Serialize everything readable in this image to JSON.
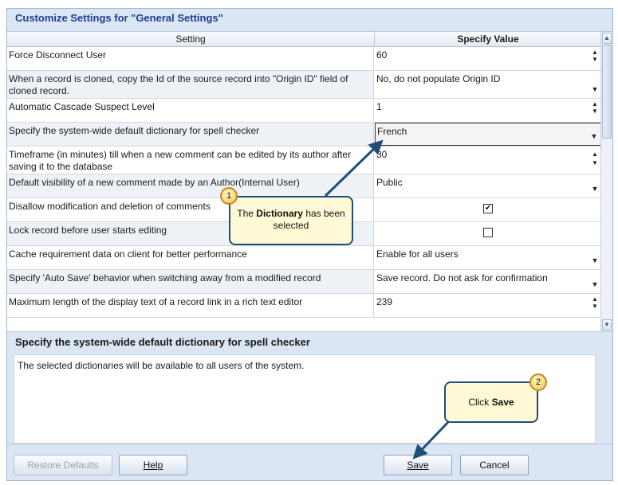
{
  "dialog": {
    "title": "Customize Settings for \"General Settings\""
  },
  "grid": {
    "header_setting": "Setting",
    "header_value": "Specify Value",
    "rows": [
      {
        "setting": "Force Disconnect User",
        "value": "60",
        "control": "spin"
      },
      {
        "setting": "When a record is cloned, copy the Id of the source record into \"Origin ID\" field of cloned record.",
        "value": "No, do not populate Origin ID",
        "control": "dropdown"
      },
      {
        "setting": "Automatic Cascade Suspect Level",
        "value": "1",
        "control": "spin"
      },
      {
        "setting": "Specify the system-wide default dictionary for spell checker",
        "value": "French",
        "control": "dropdown"
      },
      {
        "setting": "Timeframe (in minutes) till when a new comment can be edited by its author after saving it to the database",
        "value": "30",
        "control": "spin"
      },
      {
        "setting": "Default visibility of a new comment made by an Author(Internal User)",
        "value": "Public",
        "control": "dropdown"
      },
      {
        "setting": "Disallow modification and deletion of comments",
        "value": "✔",
        "control": "checkbox"
      },
      {
        "setting": "Lock record before user starts editing",
        "value": "",
        "control": "checkbox"
      },
      {
        "setting": "Cache requirement data on client for better performance",
        "value": "Enable for all users",
        "control": "dropdown"
      },
      {
        "setting": "Specify 'Auto Save' behavior when switching away from a modified record",
        "value": "Save record. Do not ask for confirmation",
        "control": "dropdown"
      },
      {
        "setting": "Maximum length of the display text of a record link in a rich text editor",
        "value": "239",
        "control": "spin"
      }
    ]
  },
  "description": {
    "title": "Specify the system-wide default dictionary for spell checker",
    "body": "The selected dictionaries will be available to all users of the system."
  },
  "buttons": {
    "restore_defaults": "Restore Defaults",
    "help": "Help",
    "save": "Save",
    "cancel": "Cancel"
  },
  "callouts": {
    "one": {
      "number": "1",
      "text_pre": "The ",
      "text_bold": "Dictionary",
      "text_post": " has been selected"
    },
    "two": {
      "number": "2",
      "text_pre": "Click ",
      "text_bold": "Save"
    }
  },
  "glyphs": {
    "spin_up": "▲",
    "spin_down": "▼",
    "dropdown": "▼",
    "scroll_up": "▲",
    "scroll_down": "▼"
  },
  "colors": {
    "title": "#1c3f8f",
    "callout_bg": "#fff9d6",
    "callout_border": "#1f4e79",
    "arrow": "#1f4e79"
  }
}
